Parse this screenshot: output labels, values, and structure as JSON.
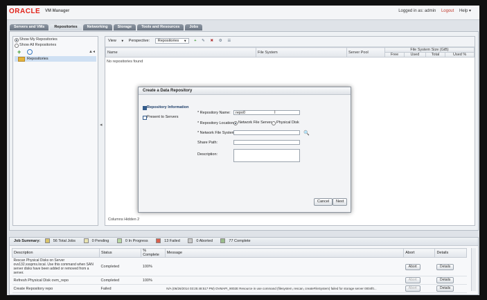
{
  "header": {
    "logo": "ORACLE",
    "app_title": "VM Manager",
    "logged_in_label": "Logged in as:",
    "user": "admin",
    "logout": "Logout",
    "help": "Help"
  },
  "tabs": [
    "Servers and VMs",
    "Repositories",
    "Networking",
    "Storage",
    "Tools and Resources",
    "Jobs"
  ],
  "active_tab": "Repositories",
  "left_panel": {
    "show_my": "Show My Repositories",
    "show_all": "Show All Repositories",
    "tree_item": "Repositories"
  },
  "toolbar": {
    "view": "View",
    "perspective_label": "Perspective:",
    "perspective_value": "Repositories"
  },
  "grid": {
    "columns": [
      "Name",
      "File System",
      "Server Pool"
    ],
    "group_header": "File System Size (GiB)",
    "size_columns": [
      "Free",
      "Used",
      "Total",
      "Used %"
    ],
    "empty": "No repositories found",
    "columns_hidden": "Columns Hidden  2"
  },
  "dialog": {
    "title": "Create a Data Repository",
    "steps": [
      "Repository Information",
      "Present to Servers"
    ],
    "name_label": "* Repository Name:",
    "name_value": "repo0",
    "location_label": "* Repository Location:",
    "location_nfs": "Network File Server",
    "location_disk": "Physical Disk",
    "nfs_label": "* Network File System:",
    "share_label": "Share Path:",
    "desc_label": "Description:",
    "cancel": "Cancel",
    "next": "Next"
  },
  "job_summary": {
    "title": "Job Summary:",
    "total": "56 Total Jobs",
    "pending": "0 Pending",
    "in_progress": "0 In Progress",
    "failed": "13 Failed",
    "aborted": "0 Aborted",
    "complete": "77 Complete"
  },
  "jobs": {
    "columns": [
      "Description",
      "Status",
      "% Complete",
      "Message",
      "Abort",
      "Details"
    ],
    "rows": [
      {
        "description": "Rescan Physical Disks on Server ovs132.xsspms.local. Use this command when SAN server disks have been added or removed from a server.",
        "status": "Completed",
        "percent": "100%",
        "message": "",
        "abort": "Abort",
        "details": "Details"
      },
      {
        "description": "Refresh Physical Disk ovm_repo",
        "status": "Completed",
        "percent": "100%",
        "message": "",
        "abort": "Abort",
        "details": "Details"
      },
      {
        "description": "Create Repository repo",
        "status": "Failed",
        "percent": "",
        "message": "N/A (06/26/2014 03:25:48:517 PM) OVMAPI_9002E Resource in use command (filesystem, rescan, createFileSystem) failed for storage server 0004f0...",
        "abort": "Abort",
        "details": "Details"
      }
    ]
  }
}
